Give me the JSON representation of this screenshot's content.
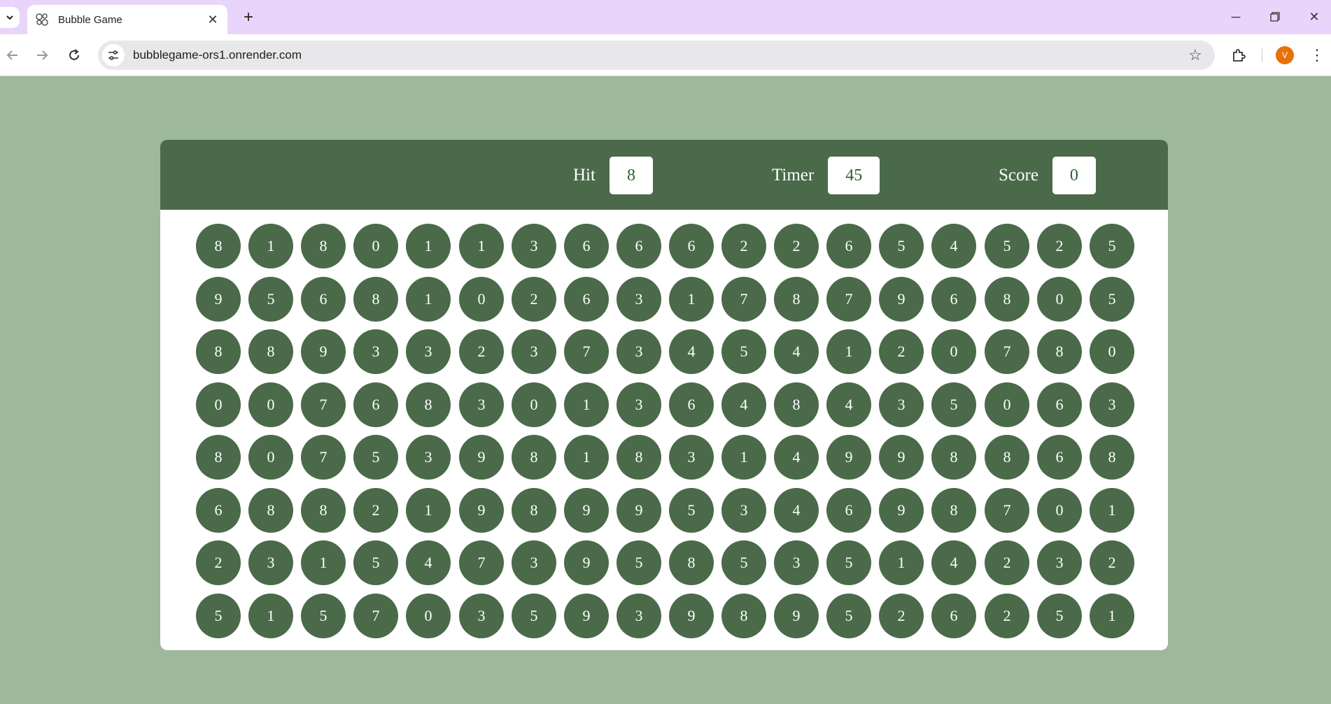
{
  "browser": {
    "tab_title": "Bubble Game",
    "url": "bubblegame-ors1.onrender.com",
    "avatar_letter": "V",
    "avatar_color": "#e8710a"
  },
  "game": {
    "hit_label": "Hit",
    "hit_value": "8",
    "timer_label": "Timer",
    "timer_value": "45",
    "score_label": "Score",
    "score_value": "0",
    "accent_color": "#4a6a4a",
    "bubbles": [
      [
        "8",
        "1",
        "8",
        "0",
        "1",
        "1",
        "3",
        "6",
        "6",
        "6",
        "2",
        "2",
        "6",
        "5",
        "4",
        "5",
        "2",
        "5"
      ],
      [
        "9",
        "5",
        "6",
        "8",
        "1",
        "0",
        "2",
        "6",
        "3",
        "1",
        "7",
        "8",
        "7",
        "9",
        "6",
        "8",
        "0",
        "5"
      ],
      [
        "8",
        "8",
        "9",
        "3",
        "3",
        "2",
        "3",
        "7",
        "3",
        "4",
        "5",
        "4",
        "1",
        "2",
        "0",
        "7",
        "8",
        "0"
      ],
      [
        "0",
        "0",
        "7",
        "6",
        "8",
        "3",
        "0",
        "1",
        "3",
        "6",
        "4",
        "8",
        "4",
        "3",
        "5",
        "0",
        "6",
        "3"
      ],
      [
        "8",
        "0",
        "7",
        "5",
        "3",
        "9",
        "8",
        "1",
        "8",
        "3",
        "1",
        "4",
        "9",
        "9",
        "8",
        "8",
        "6",
        "8"
      ],
      [
        "6",
        "8",
        "8",
        "2",
        "1",
        "9",
        "8",
        "9",
        "9",
        "5",
        "3",
        "4",
        "6",
        "9",
        "8",
        "7",
        "0",
        "1"
      ],
      [
        "2",
        "3",
        "1",
        "5",
        "4",
        "7",
        "3",
        "9",
        "5",
        "8",
        "5",
        "3",
        "5",
        "1",
        "4",
        "2",
        "3",
        "2"
      ],
      [
        "5",
        "1",
        "5",
        "7",
        "0",
        "3",
        "5",
        "9",
        "3",
        "9",
        "8",
        "9",
        "5",
        "2",
        "6",
        "2",
        "5",
        "1"
      ]
    ]
  }
}
